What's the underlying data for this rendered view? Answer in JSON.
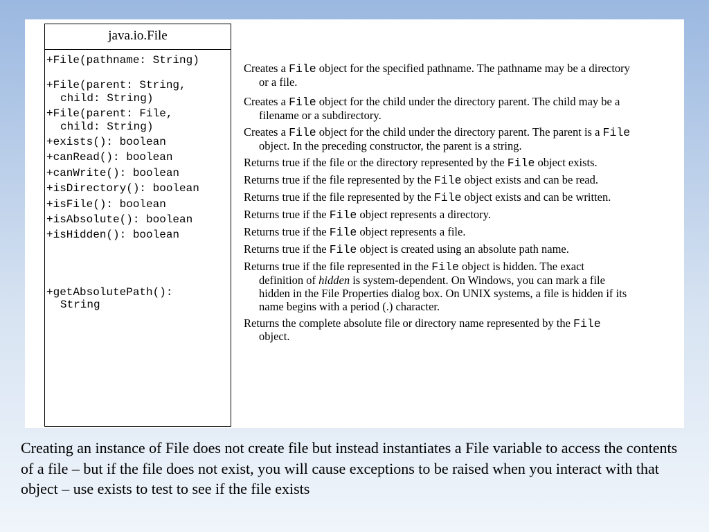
{
  "uml": {
    "title": "java.io.File",
    "rows": [
      {
        "sig": "+File(pathname: String)"
      },
      {
        "sig": "+File(parent: String,",
        "cont": "child: String)"
      },
      {
        "sig": "+File(parent: File,",
        "cont": "child: String)"
      },
      {
        "sig": "+exists(): boolean"
      },
      {
        "sig": "+canRead(): boolean"
      },
      {
        "sig": "+canWrite(): boolean"
      },
      {
        "sig": "+isDirectory(): boolean"
      },
      {
        "sig": "+isFile(): boolean"
      },
      {
        "sig": "+isAbsolute(): boolean"
      },
      {
        "sig": "+isHidden(): boolean"
      },
      {
        "spacer": true
      },
      {
        "sig": "+getAbsolutePath():",
        "cont": "String"
      }
    ]
  },
  "desc": {
    "rows": [
      {
        "l1a": "Creates a ",
        "m1": "File",
        "l1b": " object for the specified pathname. The pathname may be a directory",
        "l2": "or a file."
      },
      {
        "l1a": "Creates a ",
        "m1": "File",
        "l1b": " object for the child under the directory parent. The child may be a",
        "l2": "filename or a subdirectory."
      },
      {
        "l1a": "Creates a ",
        "m1": "File",
        "l1b": " object for the child under the directory parent. The parent is a ",
        "m2": "File",
        "l2": "object. In the preceding constructor, the parent is a string."
      },
      {
        "l1a": "Returns true if the file or the directory represented by the ",
        "m1": "File",
        "l1b": " object exists."
      },
      {
        "l1a": "Returns true if the file represented by the ",
        "m1": "File",
        "l1b": " object exists and can be read."
      },
      {
        "l1a": "Returns true if the file represented by the ",
        "m1": "File",
        "l1b": " object exists and can be written."
      },
      {
        "l1a": "Returns true if the ",
        "m1": "File",
        "l1b": " object represents a directory."
      },
      {
        "l1a": "Returns true if the ",
        "m1": "File",
        "l1b": " object represents a file."
      },
      {
        "l1a": "Returns true if the ",
        "m1": "File",
        "l1b": " object is created using an absolute path name."
      },
      {
        "l1a": "Returns true if the file represented in the ",
        "m1": "File",
        "l1b": " object is hidden. The exact",
        "l2a": "definition of ",
        "i2": "hidden",
        "l2b": " is system-dependent. On Windows, you can mark a file",
        "l3": "hidden in the File Properties dialog box. On UNIX systems, a file is hidden if its",
        "l4": "name begins with a period (.) character."
      },
      {
        "l1a": "Returns the complete absolute file or directory name represented by the ",
        "m1": "File",
        "l2": "object."
      }
    ]
  },
  "caption": "Creating an instance of File does not create file but instead instantiates a File variable to access the contents of a file – but if the file does not exist, you will cause exceptions to be raised when you interact with that object – use exists to test to see if the file exists"
}
